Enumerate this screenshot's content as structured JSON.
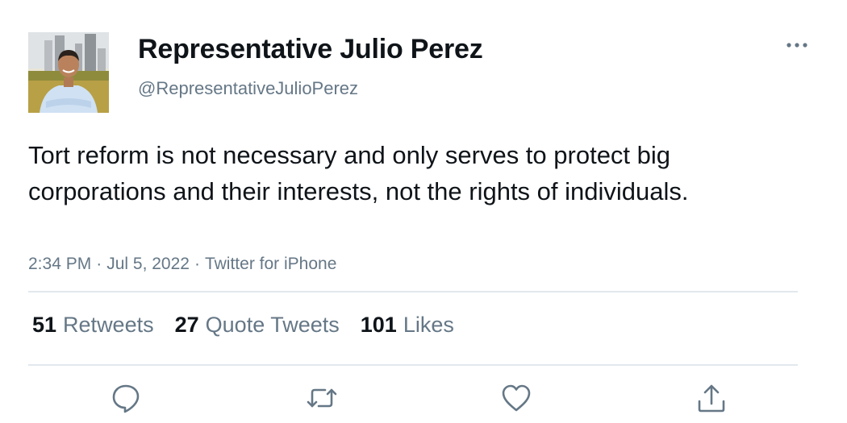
{
  "author": {
    "display_name": "Representative Julio Perez",
    "handle": "@RepresentativeJulioPerez"
  },
  "tweet": {
    "text": "Tort reform is not necessary and only serves to protect big corporations and their interests, not the rights of individuals.",
    "time": "2:34 PM",
    "date": "Jul 5, 2022",
    "source": "Twitter for iPhone",
    "separator": "·"
  },
  "stats": {
    "retweets_count": "51",
    "retweets_label": "Retweets",
    "quotes_count": "27",
    "quotes_label": "Quote Tweets",
    "likes_count": "101",
    "likes_label": "Likes"
  },
  "icons": {
    "more": "more-icon",
    "reply": "reply-icon",
    "retweet": "retweet-icon",
    "like": "like-icon",
    "share": "share-icon"
  },
  "colors": {
    "text": "#0f1419",
    "secondary": "#657786",
    "divider": "#e1e8ed"
  }
}
